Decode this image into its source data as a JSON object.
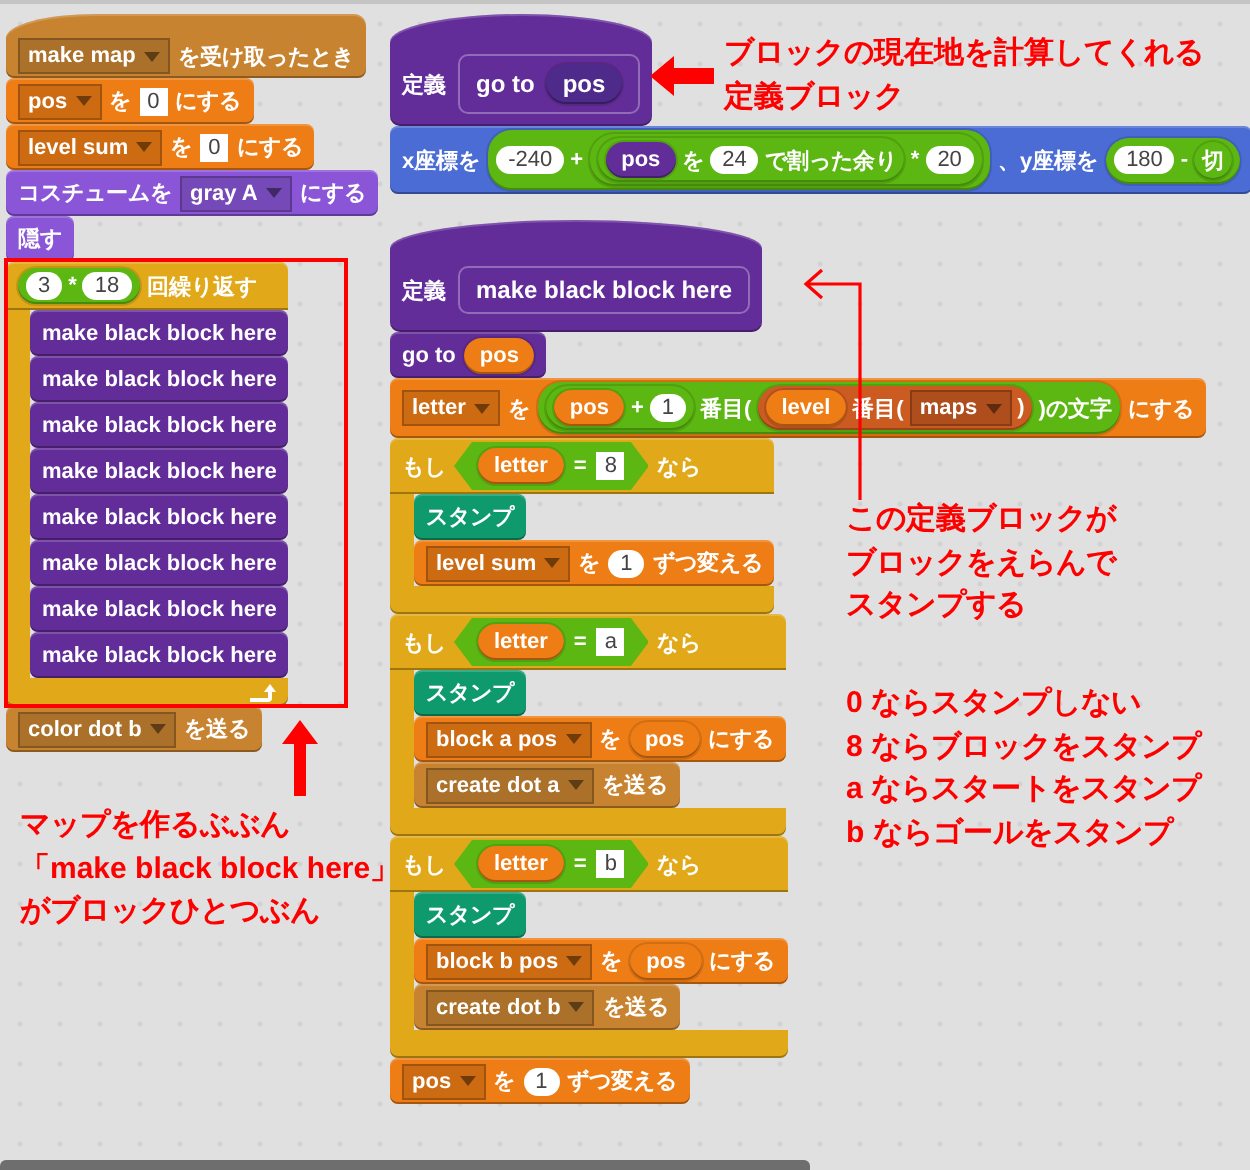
{
  "scripts": [
    {
      "blocks": [
        {
          "kind": "hat",
          "color": "#c88330",
          "parts": [
            {
              "kind": "dropdown",
              "text": "make map"
            },
            {
              "kind": "text",
              "text": "を受け取ったとき"
            }
          ]
        },
        {
          "kind": "stack",
          "color": "#ee7d16",
          "parts": [
            {
              "kind": "dropdown",
              "text": "pos"
            },
            {
              "kind": "text",
              "text": "を"
            },
            {
              "kind": "field",
              "text": "0"
            },
            {
              "kind": "text",
              "text": "にする"
            }
          ]
        },
        {
          "kind": "stack",
          "color": "#ee7d16",
          "parts": [
            {
              "kind": "dropdown",
              "text": "level sum"
            },
            {
              "kind": "text",
              "text": "を"
            },
            {
              "kind": "field",
              "text": "0"
            },
            {
              "kind": "text",
              "text": "にする"
            }
          ]
        },
        {
          "kind": "stack",
          "color": "#8a55d7",
          "parts": [
            {
              "kind": "text",
              "text": "コスチュームを"
            },
            {
              "kind": "dropdown",
              "text": "gray A"
            },
            {
              "kind": "text",
              "text": "にする"
            }
          ]
        },
        {
          "kind": "stack",
          "color": "#8a55d7",
          "parts": [
            {
              "kind": "text",
              "text": "隠す"
            }
          ]
        },
        {
          "kind": "c",
          "color": "#e1a91a",
          "loop": true,
          "parts": [
            {
              "kind": "op",
              "color": "#5cb712",
              "parts": [
                {
                  "kind": "number",
                  "text": "3"
                },
                {
                  "kind": "text",
                  "text": "*"
                },
                {
                  "kind": "number",
                  "text": "18"
                }
              ]
            },
            {
              "kind": "text",
              "text": "回繰り返す"
            }
          ],
          "children": [
            {
              "kind": "stack",
              "color": "#632d99",
              "parts": [
                {
                  "kind": "text",
                  "text": "make black block here"
                }
              ]
            },
            {
              "kind": "stack",
              "color": "#632d99",
              "parts": [
                {
                  "kind": "text",
                  "text": "make black block here"
                }
              ]
            },
            {
              "kind": "stack",
              "color": "#632d99",
              "parts": [
                {
                  "kind": "text",
                  "text": "make black block here"
                }
              ]
            },
            {
              "kind": "stack",
              "color": "#632d99",
              "parts": [
                {
                  "kind": "text",
                  "text": "make black block here"
                }
              ]
            },
            {
              "kind": "stack",
              "color": "#632d99",
              "parts": [
                {
                  "kind": "text",
                  "text": "make black block here"
                }
              ]
            },
            {
              "kind": "stack",
              "color": "#632d99",
              "parts": [
                {
                  "kind": "text",
                  "text": "make black block here"
                }
              ]
            },
            {
              "kind": "stack",
              "color": "#632d99",
              "parts": [
                {
                  "kind": "text",
                  "text": "make black block here"
                }
              ]
            },
            {
              "kind": "stack",
              "color": "#632d99",
              "parts": [
                {
                  "kind": "text",
                  "text": "make black block here"
                }
              ]
            }
          ]
        },
        {
          "kind": "stack",
          "color": "#c88330",
          "parts": [
            {
              "kind": "dropdown",
              "text": "color dot b"
            },
            {
              "kind": "text",
              "text": "を送る"
            }
          ]
        }
      ]
    },
    {
      "blocks": [
        {
          "kind": "define",
          "color": "#632d99",
          "parts": [
            {
              "kind": "text",
              "text": "定義"
            },
            {
              "kind": "proto",
              "parts": [
                {
                  "kind": "text",
                  "text": "go to"
                },
                {
                  "kind": "var",
                  "color": "#4e2a8a",
                  "text": "pos"
                }
              ]
            }
          ]
        },
        {
          "kind": "stack",
          "color": "#4a6cd4",
          "parts": [
            {
              "kind": "text",
              "text": "x座標を"
            },
            {
              "kind": "op",
              "color": "#5cb712",
              "parts": [
                {
                  "kind": "number",
                  "text": "-240"
                },
                {
                  "kind": "text",
                  "text": "+"
                },
                {
                  "kind": "op",
                  "color": "#5cb712",
                  "parts": [
                    {
                      "kind": "op",
                      "color": "#5cb712",
                      "parts": [
                        {
                          "kind": "var",
                          "color": "#632d99",
                          "text": "pos"
                        },
                        {
                          "kind": "text",
                          "text": "を"
                        },
                        {
                          "kind": "number",
                          "text": "24"
                        },
                        {
                          "kind": "text",
                          "text": "で割った余り"
                        }
                      ]
                    },
                    {
                      "kind": "text",
                      "text": "*"
                    },
                    {
                      "kind": "number",
                      "text": "20"
                    }
                  ]
                }
              ]
            },
            {
              "kind": "text",
              "text": "、y座標を"
            },
            {
              "kind": "op",
              "color": "#5cb712",
              "parts": [
                {
                  "kind": "number",
                  "text": "180"
                },
                {
                  "kind": "text",
                  "text": "-"
                },
                {
                  "kind": "op",
                  "color": "#5cb712",
                  "parts": [
                    {
                      "kind": "text",
                      "text": "切"
                    }
                  ]
                }
              ]
            }
          ]
        }
      ]
    },
    {
      "blocks": [
        {
          "kind": "define",
          "color": "#632d99",
          "parts": [
            {
              "kind": "text",
              "text": "定義"
            },
            {
              "kind": "proto",
              "parts": [
                {
                  "kind": "text",
                  "text": "make black block here"
                }
              ]
            }
          ]
        },
        {
          "kind": "stack",
          "color": "#632d99",
          "parts": [
            {
              "kind": "text",
              "text": "go to"
            },
            {
              "kind": "var",
              "color": "#ee7d16",
              "text": "pos"
            }
          ]
        },
        {
          "kind": "stack",
          "color": "#ee7d16",
          "parts": [
            {
              "kind": "dropdown",
              "text": "letter"
            },
            {
              "kind": "text",
              "text": "を"
            },
            {
              "kind": "op",
              "color": "#5cb712",
              "parts": [
                {
                  "kind": "op",
                  "color": "#5cb712",
                  "parts": [
                    {
                      "kind": "var",
                      "color": "#ee7d16",
                      "text": "pos"
                    },
                    {
                      "kind": "text",
                      "text": "+"
                    },
                    {
                      "kind": "number",
                      "text": "1"
                    }
                  ]
                },
                {
                  "kind": "text",
                  "text": "番目("
                },
                {
                  "kind": "op",
                  "color": "#cc5b22",
                  "parts": [
                    {
                      "kind": "var",
                      "color": "#ee7d16",
                      "text": "level"
                    },
                    {
                      "kind": "text",
                      "text": "番目("
                    },
                    {
                      "kind": "dropdown",
                      "text": "maps"
                    },
                    {
                      "kind": "text",
                      "text": ")"
                    }
                  ]
                },
                {
                  "kind": "text",
                  "text": ")の文字"
                }
              ]
            },
            {
              "kind": "text",
              "text": "にする"
            }
          ]
        },
        {
          "kind": "c",
          "color": "#e1a91a",
          "loop": false,
          "parts": [
            {
              "kind": "text",
              "text": "もし"
            },
            {
              "kind": "bool",
              "parts": [
                {
                  "kind": "var",
                  "color": "#ee7d16",
                  "text": "letter"
                },
                {
                  "kind": "text",
                  "text": "="
                },
                {
                  "kind": "field",
                  "text": "8"
                }
              ]
            },
            {
              "kind": "text",
              "text": "なら"
            }
          ],
          "children": [
            {
              "kind": "stack",
              "color": "#0e9a6c",
              "parts": [
                {
                  "kind": "text",
                  "text": "スタンプ"
                }
              ]
            },
            {
              "kind": "stack",
              "color": "#ee7d16",
              "parts": [
                {
                  "kind": "dropdown",
                  "text": "level sum"
                },
                {
                  "kind": "text",
                  "text": "を"
                },
                {
                  "kind": "number",
                  "text": "1"
                },
                {
                  "kind": "text",
                  "text": "ずつ変える"
                }
              ]
            }
          ]
        },
        {
          "kind": "c",
          "color": "#e1a91a",
          "loop": false,
          "parts": [
            {
              "kind": "text",
              "text": "もし"
            },
            {
              "kind": "bool",
              "parts": [
                {
                  "kind": "var",
                  "color": "#ee7d16",
                  "text": "letter"
                },
                {
                  "kind": "text",
                  "text": "="
                },
                {
                  "kind": "field",
                  "text": "a"
                }
              ]
            },
            {
              "kind": "text",
              "text": "なら"
            }
          ],
          "children": [
            {
              "kind": "stack",
              "color": "#0e9a6c",
              "parts": [
                {
                  "kind": "text",
                  "text": "スタンプ"
                }
              ]
            },
            {
              "kind": "stack",
              "color": "#ee7d16",
              "parts": [
                {
                  "kind": "dropdown",
                  "text": "block a pos"
                },
                {
                  "kind": "text",
                  "text": "を"
                },
                {
                  "kind": "var",
                  "color": "#ee7d16",
                  "text": "pos"
                },
                {
                  "kind": "text",
                  "text": "にする"
                }
              ]
            },
            {
              "kind": "stack",
              "color": "#c88330",
              "parts": [
                {
                  "kind": "dropdown",
                  "text": "create dot a"
                },
                {
                  "kind": "text",
                  "text": "を送る"
                }
              ]
            }
          ]
        },
        {
          "kind": "c",
          "color": "#e1a91a",
          "loop": false,
          "parts": [
            {
              "kind": "text",
              "text": "もし"
            },
            {
              "kind": "bool",
              "parts": [
                {
                  "kind": "var",
                  "color": "#ee7d16",
                  "text": "letter"
                },
                {
                  "kind": "text",
                  "text": "="
                },
                {
                  "kind": "field",
                  "text": "b"
                }
              ]
            },
            {
              "kind": "text",
              "text": "なら"
            }
          ],
          "children": [
            {
              "kind": "stack",
              "color": "#0e9a6c",
              "parts": [
                {
                  "kind": "text",
                  "text": "スタンプ"
                }
              ]
            },
            {
              "kind": "stack",
              "color": "#ee7d16",
              "parts": [
                {
                  "kind": "dropdown",
                  "text": "block b pos"
                },
                {
                  "kind": "text",
                  "text": "を"
                },
                {
                  "kind": "var",
                  "color": "#ee7d16",
                  "text": "pos"
                },
                {
                  "kind": "text",
                  "text": "にする"
                }
              ]
            },
            {
              "kind": "stack",
              "color": "#c88330",
              "parts": [
                {
                  "kind": "dropdown",
                  "text": "create dot b"
                },
                {
                  "kind": "text",
                  "text": "を送る"
                }
              ]
            }
          ]
        },
        {
          "kind": "stack",
          "color": "#ee7d16",
          "parts": [
            {
              "kind": "dropdown",
              "text": "pos"
            },
            {
              "kind": "text",
              "text": "を"
            },
            {
              "kind": "number",
              "text": "1"
            },
            {
              "kind": "text",
              "text": "ずつ変える"
            }
          ]
        }
      ]
    }
  ],
  "annotations": [
    {
      "lines": [
        "ブロックの現在地を計算してくれる",
        "定義ブロック"
      ]
    },
    {
      "lines": [
        "この定義ブロックが",
        "ブロックをえらんで",
        "スタンプする"
      ]
    },
    {
      "lines": [
        "0 ならスタンプしない",
        "8 ならブロックをスタンプ",
        "a ならスタートをスタンプ",
        "b ならゴールをスタンプ"
      ]
    },
    {
      "lines": [
        "マップを作るぶぶん",
        "「make black block here」",
        "がブロックひとつぶん"
      ]
    }
  ]
}
